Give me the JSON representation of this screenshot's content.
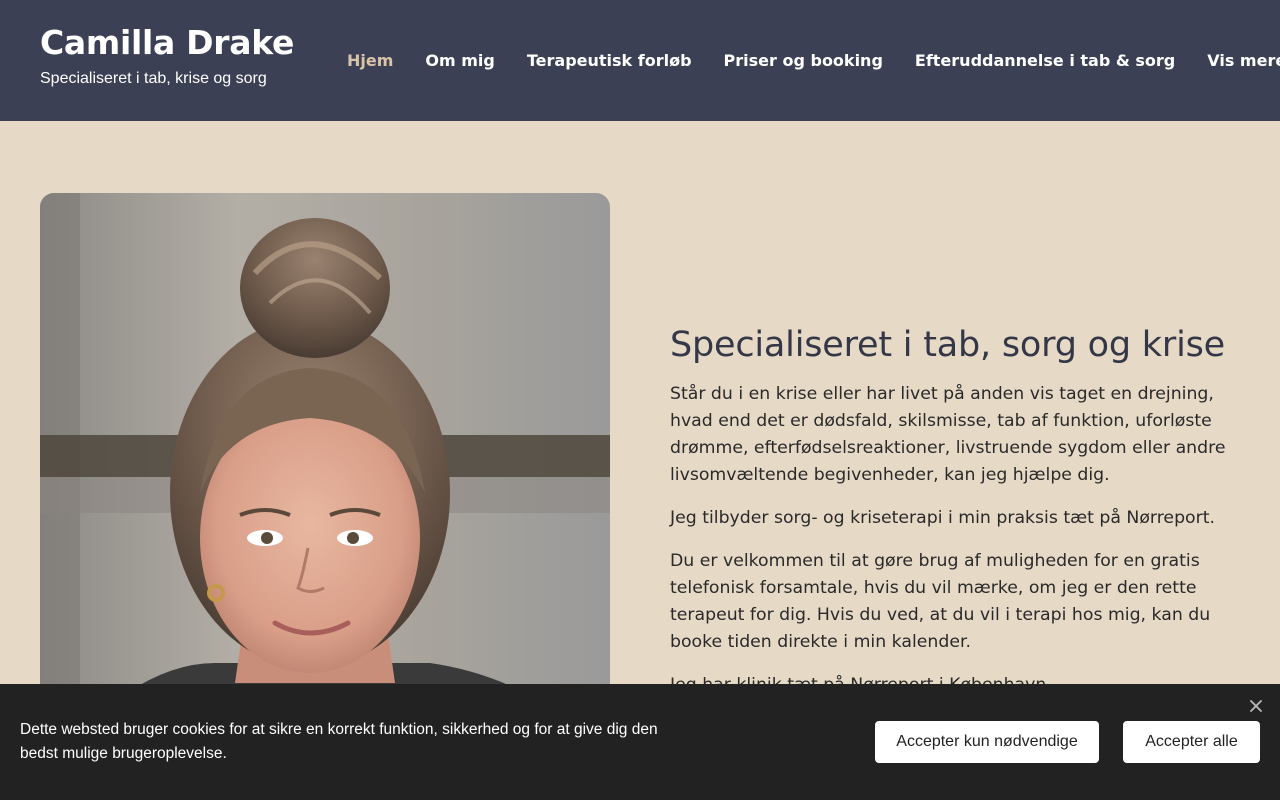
{
  "site": {
    "title": "Camilla Drake",
    "tagline": "Specialiseret i tab, krise og sorg"
  },
  "nav": {
    "items": [
      {
        "label": "Hjem",
        "active": true
      },
      {
        "label": "Om mig"
      },
      {
        "label": "Terapeutisk forløb"
      },
      {
        "label": "Priser og booking"
      },
      {
        "label": "Efteruddannelse i tab & sorg"
      },
      {
        "label": "Vis mere",
        "icon": "chevron-down-icon"
      }
    ]
  },
  "hero": {
    "photo_icon": "portrait-photo",
    "heading": "Specialiseret i tab, sorg og krise",
    "paragraphs": [
      "Står du i en krise eller har livet på anden vis taget en drejning, hvad end det er dødsfald, skilsmisse, tab af funktion, uforløste drømme, efterfødselsreaktioner, livstruende sygdom eller andre livsomvæltende begivenheder, kan jeg hjælpe dig.",
      "Jeg tilbyder sorg- og kriseterapi i min praksis tæt på Nørreport.",
      "Du er velkommen til at gøre brug af muligheden for en gratis telefonisk forsamtale, hvis du vil mærke, om jeg er den rette terapeut for dig. Hvis du ved, at du vil i terapi hos mig, kan du booke tiden direkte i min kalender.",
      "Jeg har klinik tæt på Nørreport i København."
    ]
  },
  "cookie": {
    "text": "Dette websted bruger cookies for at sikre en korrekt funktion, sikkerhed og for at give dig den bedst mulige brugeroplevelse.",
    "btn_necessary": "Accepter kun nødvendige",
    "btn_all": "Accepter alle",
    "close_icon": "close-icon"
  },
  "colors": {
    "header_bg": "#3b4054",
    "page_bg": "#e6d9c6",
    "nav_active": "#d9c4a8",
    "heading": "#333747",
    "cookie_bg": "#222222"
  }
}
